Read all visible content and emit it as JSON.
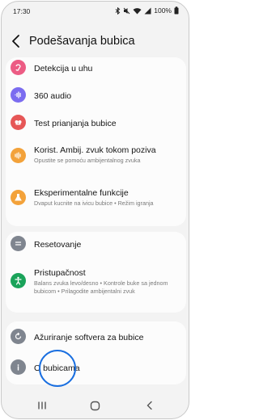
{
  "status": {
    "time": "17:30",
    "battery": "100%"
  },
  "header": {
    "title": "Podešavanja bubica"
  },
  "sections": {
    "ear_detection": {
      "label": "Detekcija u uhu"
    },
    "audio360": {
      "label": "360 audio"
    },
    "fit_test": {
      "label": "Test prianjanja bubice"
    },
    "ambient_call": {
      "label": "Korist. Ambij. zvuk tokom poziva",
      "sub": "Opustite se pomoću ambijentalnog zvuka"
    },
    "experimental": {
      "label": "Eksperimentalne funkcije",
      "sub": "Dvaput kucnite na ivicu bubice • Režim igranja"
    },
    "reset": {
      "label": "Resetovanje"
    },
    "accessibility": {
      "label": "Pristupačnost",
      "sub": "Balans zvuka levo/desno • Kontrole buke sa jednom bubicom • Prilagodite ambijentalni zvuk"
    },
    "software_update": {
      "label": "Ažuriranje softvera za bubice"
    },
    "about": {
      "label": "O bubicama"
    }
  },
  "colors": {
    "pink": "#ec5c84",
    "purple": "#7b6cf0",
    "red": "#e65757",
    "orange": "#f3a23a",
    "gray": "#7f858f",
    "green": "#1aa35a",
    "touch": "#1a6fe0"
  },
  "icons": {
    "ear_detection": "ear-icon",
    "audio360": "audio-wave-icon",
    "fit_test": "earbuds-fit-icon",
    "ambient_call": "ambient-sound-icon",
    "experimental": "flask-icon",
    "reset": "reset-icon",
    "accessibility": "accessibility-icon",
    "software_update": "update-icon",
    "about": "info-icon"
  }
}
